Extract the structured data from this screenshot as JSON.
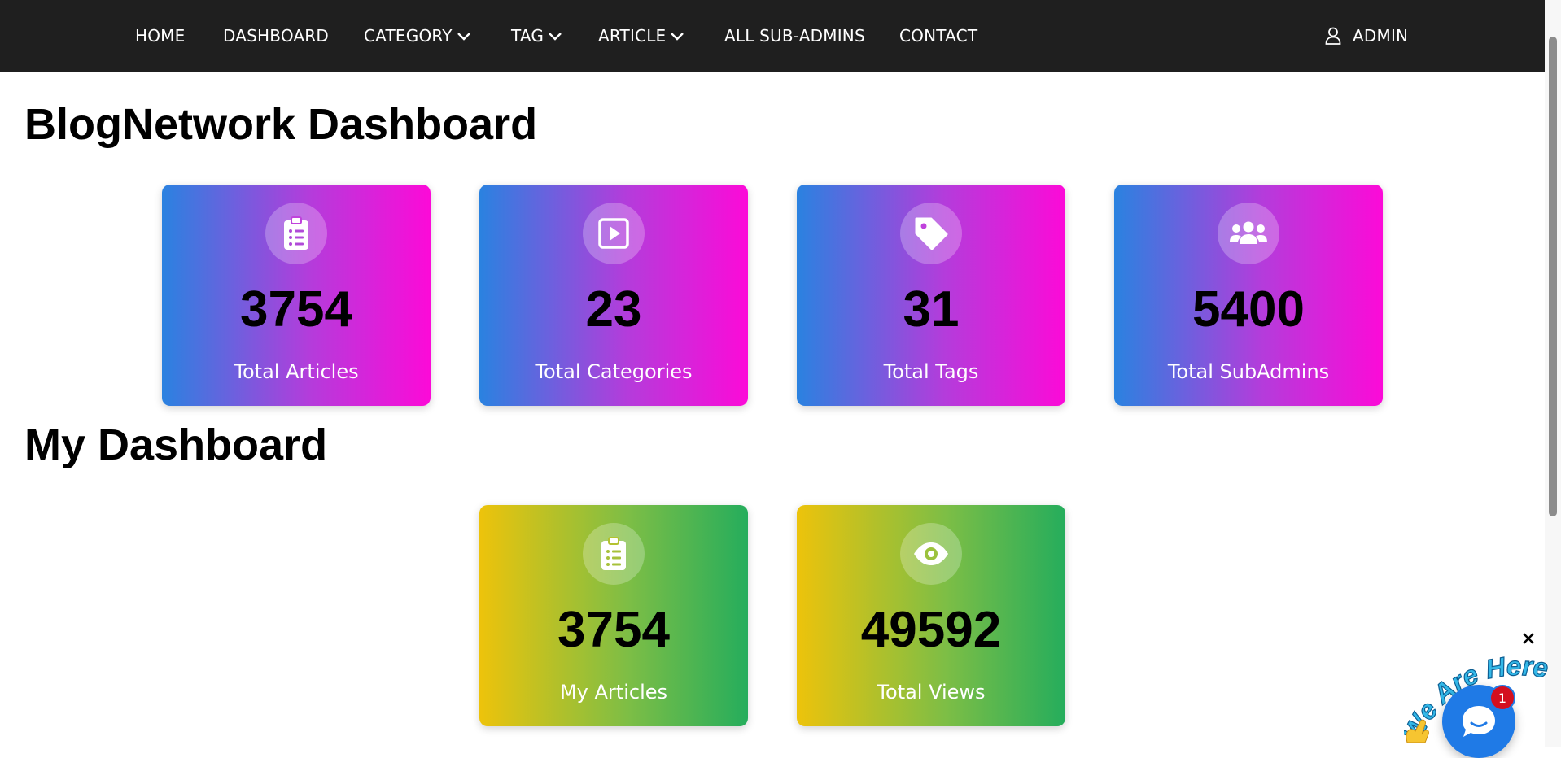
{
  "nav": {
    "home": "HOME",
    "dashboard": "DASHBOARD",
    "category": "CATEGORY",
    "tag": "TAG",
    "article": "ARTICLE",
    "sub_admins": "ALL SUB-ADMINS",
    "contact": "CONTACT",
    "admin": "ADMIN",
    "icons": {
      "dropdown": "chevron-down-icon",
      "user": "user-icon"
    }
  },
  "sections": {
    "network_title": "BlogNetwork Dashboard",
    "my_title": "My Dashboard"
  },
  "network_cards": [
    {
      "value": "3754",
      "label": "Total Articles",
      "icon": "clipboard-list-icon"
    },
    {
      "value": "23",
      "label": "Total Categories",
      "icon": "play-square-icon"
    },
    {
      "value": "31",
      "label": "Total Tags",
      "icon": "tag-icon"
    },
    {
      "value": "5400",
      "label": "Total SubAdmins",
      "icon": "users-icon"
    }
  ],
  "my_cards": [
    {
      "value": "3754",
      "label": "My Articles",
      "icon": "clipboard-list-icon"
    },
    {
      "value": "49592",
      "label": "Total Views",
      "icon": "eye-icon"
    }
  ],
  "chat": {
    "banner_text": "We Are Here!",
    "badge_count": "1",
    "icons": {
      "close": "close-icon",
      "chat": "chat-bubble-icon",
      "wave": "waving-hand-icon"
    }
  },
  "colors": {
    "navbar_bg": "#1f1f1f",
    "card_gradient_pink": [
      "#2a82e0",
      "#fc0ad8"
    ],
    "card_gradient_green": [
      "#edc30b",
      "#25ad5c"
    ],
    "chat_blue": "#1f7ae6",
    "badge_red": "#d40f1f"
  }
}
